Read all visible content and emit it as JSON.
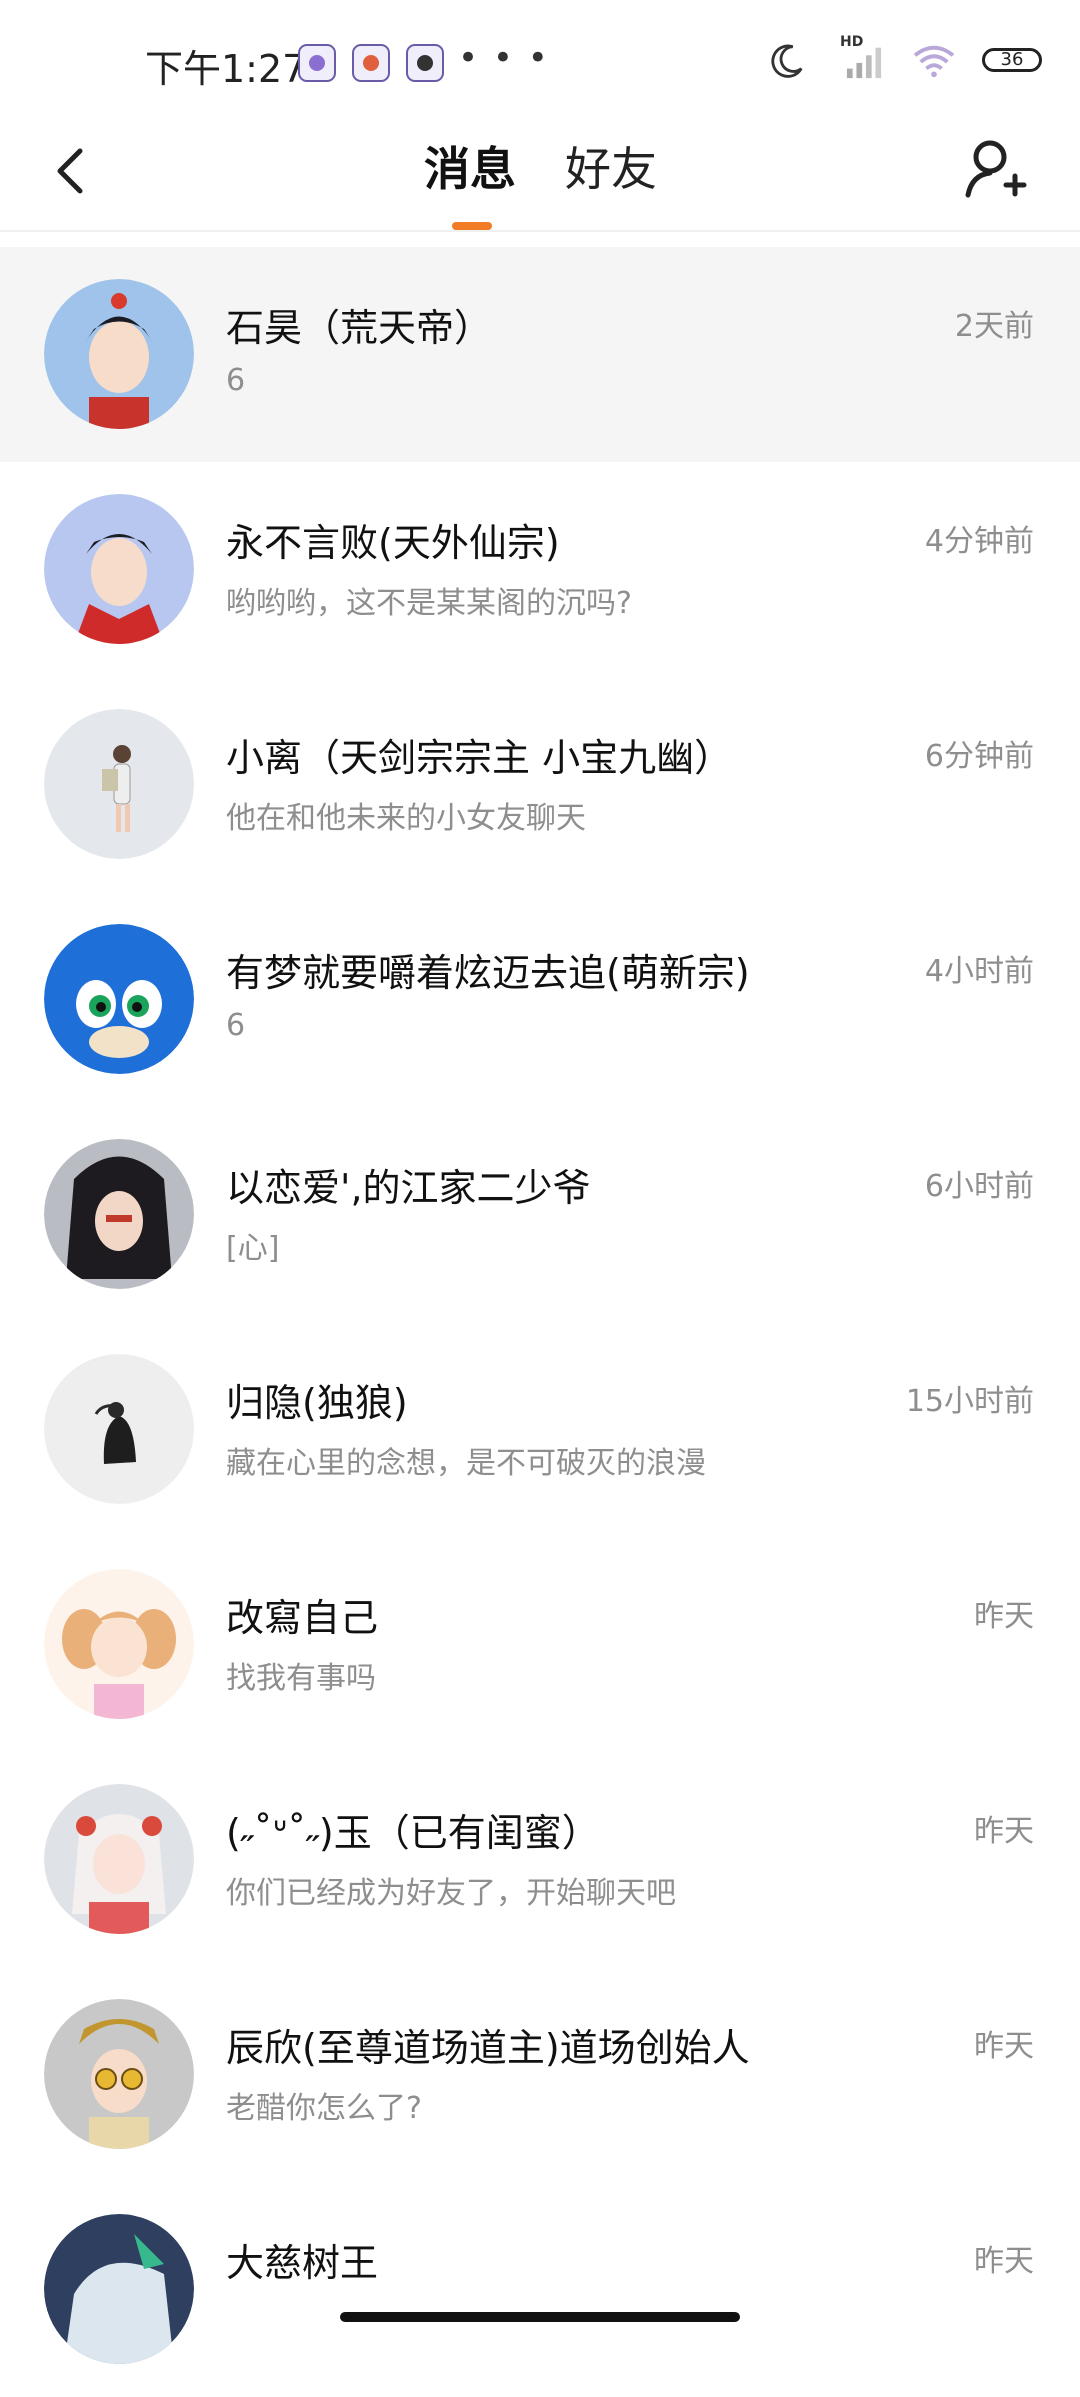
{
  "status_bar": {
    "time": "下午1:27",
    "dots": "• • •",
    "network": "HD",
    "battery": "36"
  },
  "header": {
    "tab_messages": "消息",
    "tab_friends": "好友",
    "accent_color": "#f27b25"
  },
  "conversations": [
    {
      "name": "石昊（荒天帝）",
      "preview": "6",
      "time": "2天前",
      "active": true,
      "avatar_color": "#9fc3ea"
    },
    {
      "name": "永不言败(天外仙宗)",
      "preview": "哟哟哟，这不是某某阁的沉吗?",
      "time": "4分钟前",
      "avatar_color": "#b7c7f0"
    },
    {
      "name": "小离（天剑宗宗主 小宝九幽）",
      "preview": "他在和他未来的小女友聊天",
      "time": "6分钟前",
      "avatar_color": "#e4e8ec"
    },
    {
      "name": "有梦就要嚼着炫迈去追(萌新宗)",
      "preview": "6",
      "time": "4小时前",
      "avatar_color": "#1f6fd8"
    },
    {
      "name": "以恋爱',的江家二少爷",
      "preview": "[心]",
      "time": "6小时前",
      "avatar_color": "#b9bcc2"
    },
    {
      "name": "归隐(独狼)",
      "preview": "藏在心里的念想，是不可破灭的浪漫",
      "time": "15小时前",
      "avatar_color": "#eeeeee"
    },
    {
      "name": "改寫自己",
      "preview": "找我有事吗",
      "time": "昨天",
      "avatar_color": "#f7e4d8"
    },
    {
      "name": "(˶˚ᐡ˚˶)玉（已有闺蜜）",
      "preview": "你们已经成为好友了，开始聊天吧",
      "time": "昨天",
      "avatar_color": "#f2d9dc"
    },
    {
      "name": "辰欣(至尊道场道主)道场创始人",
      "preview": "老醋你怎么了?",
      "time": "昨天",
      "avatar_color": "#c8c8c8"
    },
    {
      "name": "大慈树王",
      "preview": "",
      "time": "昨天",
      "avatar_color": "#2f3f5f"
    }
  ]
}
